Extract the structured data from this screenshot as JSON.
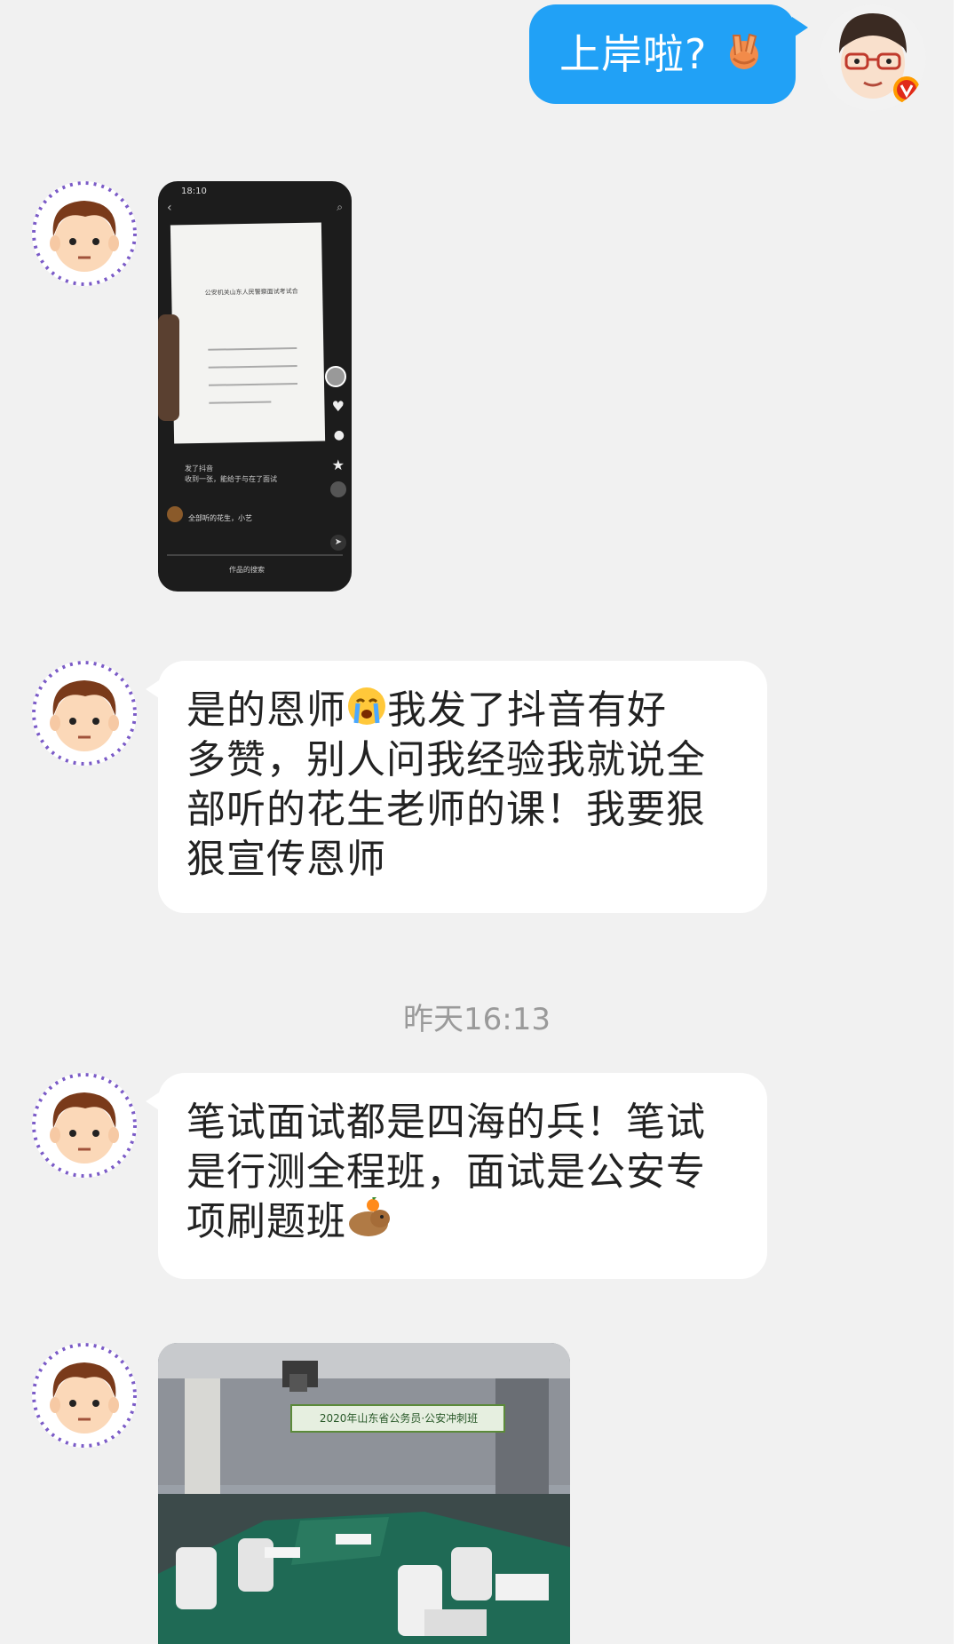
{
  "messages": {
    "m1": {
      "text": "上岸啦?",
      "emoji": "victory-hand-emoji"
    },
    "m3": {
      "text_a": "是的恩师",
      "emoji": "crying-face-emoji",
      "text_b": "我发了抖音有好",
      "line2": "多赞，别人问我经验我就说全",
      "line3": "部听的花生老师的课！我要狠",
      "line4": "狠宣传恩师"
    },
    "time": "昨天16:13",
    "m4": {
      "line1": "笔试面试都是四海的兵！笔试",
      "line2": "是行测全程班，面试是公安专",
      "line3": "项刷题班",
      "emoji": "capybara-emoji"
    }
  },
  "phone_screenshot": {
    "status_time": "18:10",
    "doc_title": "公安机关山东人民警察面试考试合",
    "caption_line1": "发了抖音",
    "caption_line2": "收到一张，能给于与在了面试",
    "comment": "全部听的花生，小艺",
    "bottom_label": "作品的搜索"
  },
  "classroom_photo": {
    "banner": "2020年山东省公务员·公安冲刺班"
  },
  "colors": {
    "outgoing_bubble": "#21a1f6",
    "incoming_bubble": "#ffffff",
    "background": "#f1f1f1"
  }
}
